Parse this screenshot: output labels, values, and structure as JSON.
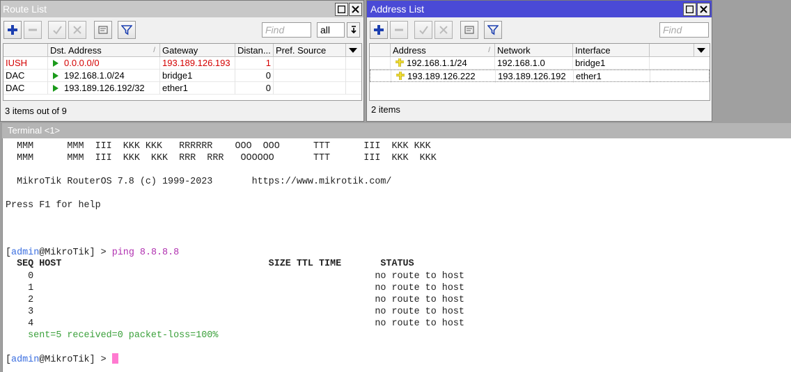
{
  "route_list": {
    "title": "Route List",
    "find_placeholder": "Find",
    "filter_value": "all",
    "columns": [
      "",
      "Dst. Address",
      "Gateway",
      "Distan...",
      "Pref. Source"
    ],
    "rows": [
      {
        "flags": "IUSH",
        "dst": "0.0.0.0/0",
        "gateway": "193.189.126.193",
        "distance": "1",
        "pref_source": "",
        "highlight": true
      },
      {
        "flags": "DAC",
        "dst": "192.168.1.0/24",
        "gateway": "bridge1",
        "distance": "0",
        "pref_source": "",
        "highlight": false
      },
      {
        "flags": "DAC",
        "dst": "193.189.126.192/32",
        "gateway": "ether1",
        "distance": "0",
        "pref_source": "",
        "highlight": false
      }
    ],
    "status": "3 items out of 9"
  },
  "address_list": {
    "title": "Address List",
    "find_placeholder": "Find",
    "columns": [
      "Address",
      "Network",
      "Interface"
    ],
    "rows": [
      {
        "address": "192.168.1.1/24",
        "network": "192.168.1.0",
        "interface": "bridge1"
      },
      {
        "address": "193.189.126.222",
        "network": "193.189.126.192",
        "interface": "ether1"
      }
    ],
    "status": "2 items"
  },
  "terminal": {
    "title": "Terminal <1>",
    "banner1": "  MMM      MMM  III  KKK KKK   RRRRRR    OOO  OOO      TTT      III  KKK KKK",
    "banner2": "  MMM      MMM  III  KKK  KKK  RRR  RRR   OOOOOO       TTT      III  KKK  KKK",
    "version": "  MikroTik RouterOS 7.8 (c) 1999-2023       https://www.mikrotik.com/",
    "help": "Press F1 for help",
    "prompt_user": "admin",
    "prompt_host": "MikroTik",
    "command": "ping 8.8.8.8",
    "header": "  SEQ HOST                                     SIZE TTL TIME       STATUS",
    "ping_rows": [
      "    0                                                             no route to host",
      "    1                                                             no route to host",
      "    2                                                             no route to host",
      "    3                                                             no route to host",
      "    4                                                             no route to host"
    ],
    "summary": "    sent=5 received=0 packet-loss=100%"
  },
  "colors": {
    "active_title": "#4a4ad6",
    "red_row": "#d40000",
    "prompt_blue": "#3a6ee0",
    "command_magenta": "#b030b0",
    "summary_green": "#3aa03a",
    "cursor": "#ff7ad0"
  }
}
